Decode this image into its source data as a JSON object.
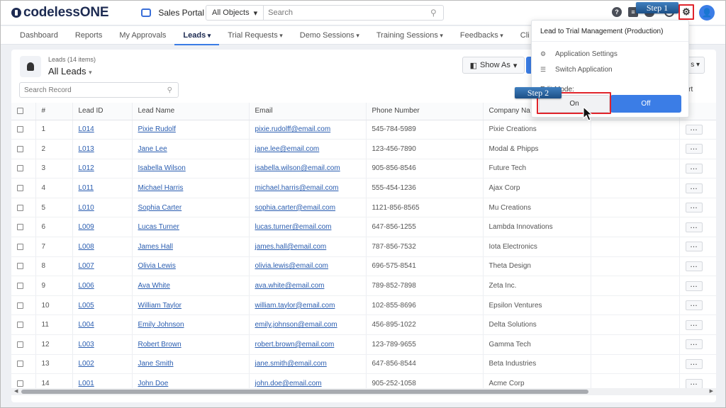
{
  "brand": {
    "name_prefix": "codeless",
    "name_suffix": "ONE"
  },
  "portal": {
    "name": "Sales Portal"
  },
  "search": {
    "object_select": "All Objects",
    "placeholder": "Search"
  },
  "nav": {
    "tabs": [
      {
        "label": "Dashboard",
        "dropdown": false
      },
      {
        "label": "Reports",
        "dropdown": false
      },
      {
        "label": "My Approvals",
        "dropdown": false
      },
      {
        "label": "Leads",
        "dropdown": true,
        "active": true
      },
      {
        "label": "Trial Requests",
        "dropdown": true
      },
      {
        "label": "Demo Sessions",
        "dropdown": true
      },
      {
        "label": "Training Sessions",
        "dropdown": true
      },
      {
        "label": "Feedbacks",
        "dropdown": true
      },
      {
        "label": "Cli",
        "dropdown": false
      }
    ]
  },
  "list": {
    "count": "Leads (14 items)",
    "title": "All Leads",
    "search_placeholder": "Search Record",
    "show_as": "Show As",
    "partial_button": "s",
    "export_partial": "port"
  },
  "table": {
    "headers": {
      "num": "#",
      "id": "Lead ID",
      "name": "Lead Name",
      "email": "Email",
      "phone": "Phone Number",
      "company": "Company Na"
    },
    "rows": [
      {
        "n": "1",
        "id": "L014",
        "name": "Pixie Rudolf",
        "email": "pixie.rudolff@email.com",
        "phone": "545-784-5989",
        "company": "Pixie Creations"
      },
      {
        "n": "2",
        "id": "L013",
        "name": "Jane Lee",
        "email": "jane.lee@email.com",
        "phone": "123-456-7890",
        "company": "Modal & Phipps"
      },
      {
        "n": "3",
        "id": "L012",
        "name": "Isabella Wilson",
        "email": "isabella.wilson@email.com",
        "phone": "905-856-8546",
        "company": "Future Tech"
      },
      {
        "n": "4",
        "id": "L011",
        "name": "Michael Harris",
        "email": "michael.harris@email.com",
        "phone": "555-454-1236",
        "company": "Ajax Corp"
      },
      {
        "n": "5",
        "id": "L010",
        "name": "Sophia Carter",
        "email": "sophia.carter@email.com",
        "phone": "1121-856-8565",
        "company": "Mu Creations"
      },
      {
        "n": "6",
        "id": "L009",
        "name": "Lucas Turner",
        "email": "lucas.turner@email.com",
        "phone": "647-856-1255",
        "company": "Lambda Innovations"
      },
      {
        "n": "7",
        "id": "L008",
        "name": "James Hall",
        "email": "james.hall@email.com",
        "phone": "787-856-7532",
        "company": "Iota Electronics"
      },
      {
        "n": "8",
        "id": "L007",
        "name": "Olivia Lewis",
        "email": "olivia.lewis@email.com",
        "phone": "696-575-8541",
        "company": "Theta Design"
      },
      {
        "n": "9",
        "id": "L006",
        "name": "Ava White",
        "email": "ava.white@email.com",
        "phone": "789-852-7898",
        "company": "Zeta Inc."
      },
      {
        "n": "10",
        "id": "L005",
        "name": "William Taylor",
        "email": "william.taylor@email.com",
        "phone": "102-855-8696",
        "company": "Epsilon Ventures"
      },
      {
        "n": "11",
        "id": "L004",
        "name": "Emily Johnson",
        "email": "emily.johnson@email.com",
        "phone": "456-895-1022",
        "company": "Delta Solutions"
      },
      {
        "n": "12",
        "id": "L003",
        "name": "Robert Brown",
        "email": "robert.brown@email.com",
        "phone": "123-789-9655",
        "company": "Gamma Tech"
      },
      {
        "n": "13",
        "id": "L002",
        "name": "Jane Smith",
        "email": "jane.smith@email.com",
        "phone": "647-856-8544",
        "company": "Beta Industries"
      },
      {
        "n": "14",
        "id": "L001",
        "name": "John Doe",
        "email": "john.doe@email.com",
        "phone": "905-252-1058",
        "company": "Acme Corp"
      }
    ]
  },
  "dropdown": {
    "title": "Lead to Trial Management (Production)",
    "items": [
      "Application Settings",
      "Switch Application"
    ],
    "mode_label": "Edit Mode:",
    "on": "On",
    "off": "Off"
  },
  "annotations": {
    "step1": "Step 1",
    "step2": "Step 2",
    "color": "#e0242b"
  },
  "colors": {
    "accent": "#3b7de6",
    "brand": "#1d2b52"
  }
}
